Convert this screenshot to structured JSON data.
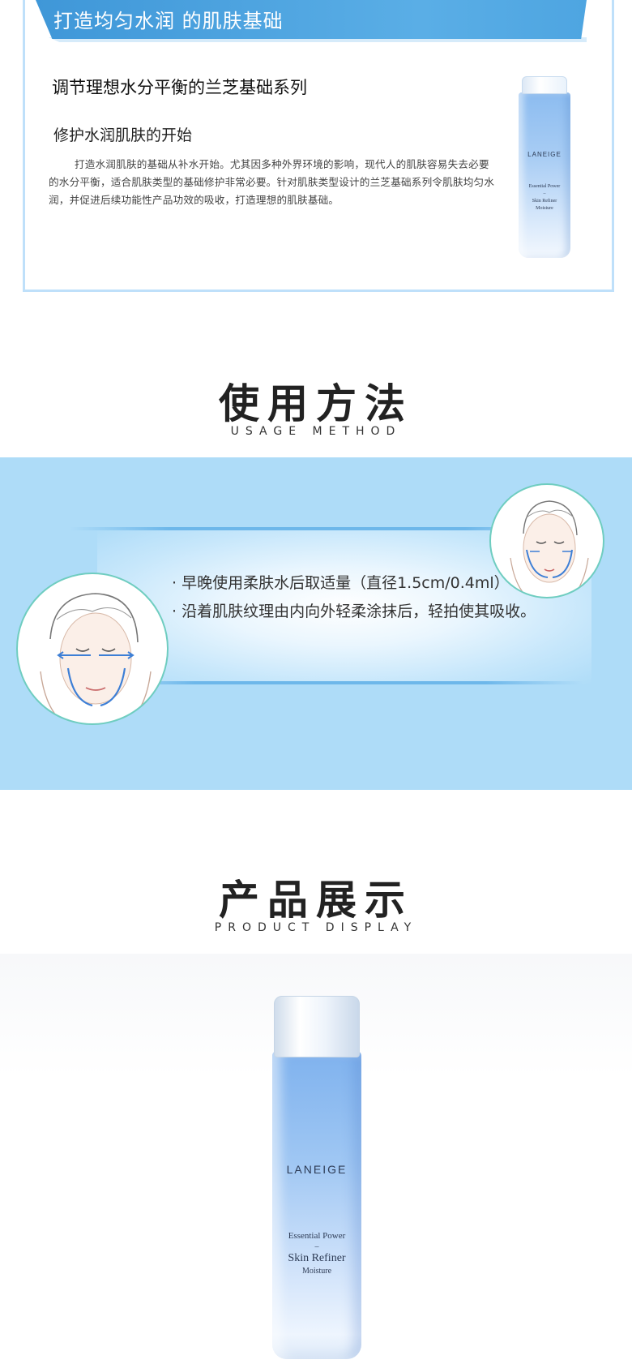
{
  "intro": {
    "banner": "打造均匀水润 的肌肤基础",
    "heading": "调节理想水分平衡的兰芝基础系列",
    "subheading": "修护水润肌肤的开始",
    "paragraph": "打造水润肌肤的基础从补水开始。尤其因多种外界环境的影响，现代人的肌肤容易失去必要的水分平衡，适合肌肤类型的基础修护非常必要。针对肌肤类型设计的兰芝基础系列令肌肤均匀水润，并促进后续功能性产品功效的吸收，打造理想的肌肤基础。"
  },
  "product_label": {
    "brand": "LANEIGE",
    "line1": "Essential Power",
    "dash": "–",
    "line2": "Skin Refiner",
    "line3": "Moisture"
  },
  "usage": {
    "title": "使用方法",
    "subtitle": "USAGE METHOD",
    "steps": [
      "· 早晚使用柔肤水后取适量（直径1.5cm/0.4ml）",
      "· 沿着肌肤纹理由内向外轻柔涂抹后，轻拍使其吸收。"
    ]
  },
  "display": {
    "title": "产品展示",
    "subtitle": "PRODUCT DISPLAY"
  },
  "colors": {
    "banner_blue": "#4ea5e1",
    "band_blue": "#aedcf8",
    "card_border": "#bfe0fa",
    "circle_border": "#6fcdc0",
    "arrow_blue": "#3d7fd6"
  }
}
